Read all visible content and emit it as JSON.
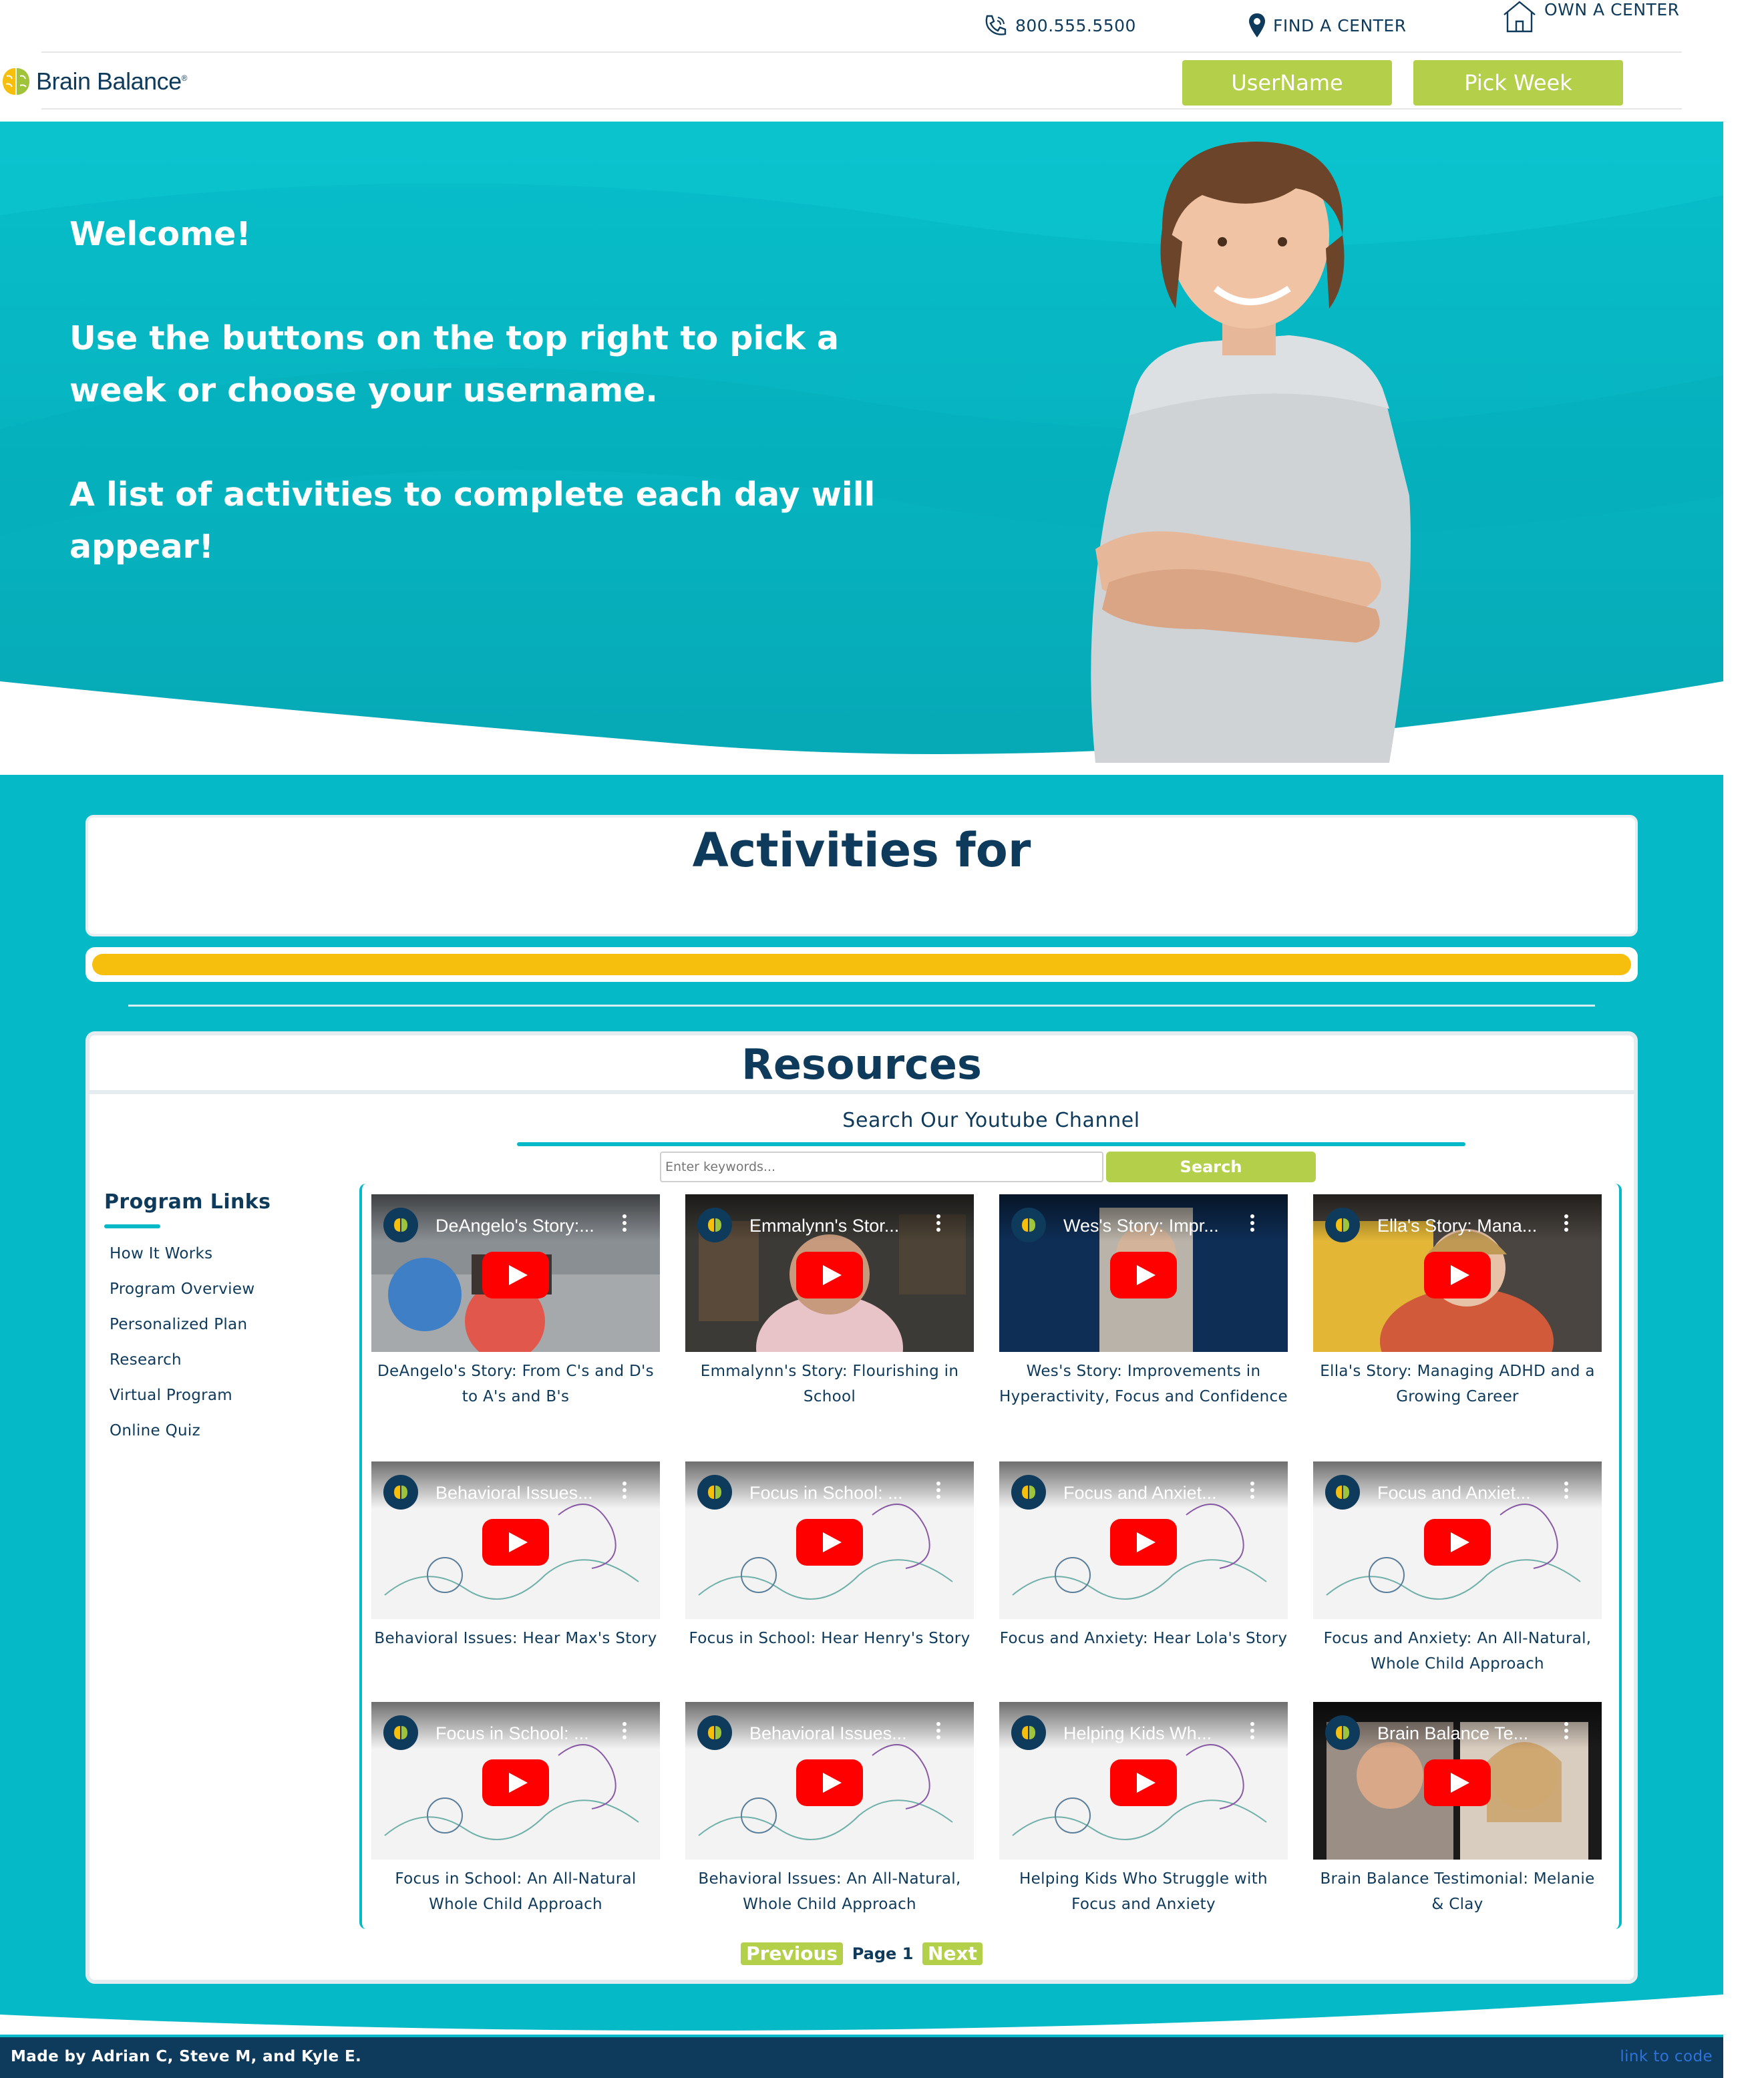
{
  "header": {
    "phone": "800.555.5500",
    "find_center": "FIND A CENTER",
    "own_center": "OWN A CENTER",
    "brand_name": "Brain Balance",
    "brand_mark": "®",
    "username_button": "UserName",
    "pick_week_button": "Pick Week"
  },
  "hero": {
    "line1": "Welcome!",
    "line2": "Use the buttons on the top right to pick a week or choose your username.",
    "line3": "A list of activities to complete each day will appear!"
  },
  "activities": {
    "title": "Activities for",
    "progress_fraction": 1.0
  },
  "resources": {
    "title": "Resources",
    "youtube_heading": "Search Our Youtube Channel",
    "search_placeholder": "Enter keywords...",
    "search_button": "Search",
    "program_links_heading": "Program Links",
    "program_links": [
      "How It Works",
      "Program Overview",
      "Personalized Plan",
      "Research",
      "Virtual Program",
      "Online Quiz"
    ],
    "videos": [
      {
        "thumb_title": "DeAngelo's Story:...",
        "caption": "DeAngelo's Story: From C's and D's to A's and B's",
        "scene": "gym"
      },
      {
        "thumb_title": "Emmalynn's Stor...",
        "caption": "Emmalynn's Story: Flourishing in School",
        "scene": "room"
      },
      {
        "thumb_title": "Wes's Story: Impr...",
        "caption": "Wes's Story: Improvements in Hyperactivity, Focus and Confidence",
        "scene": "navy"
      },
      {
        "thumb_title": "Ella's Story: Mana...",
        "caption": "Ella's Story: Managing ADHD and a Growing Career",
        "scene": "yellow"
      },
      {
        "thumb_title": "Behavioral Issues...",
        "caption": "Behavioral Issues: Hear Max's Story",
        "scene": "sketch"
      },
      {
        "thumb_title": "Focus in School: ...",
        "caption": "Focus in School: Hear Henry's Story",
        "scene": "sketch"
      },
      {
        "thumb_title": "Focus and Anxiet...",
        "caption": "Focus and Anxiety: Hear Lola's Story",
        "scene": "sketch"
      },
      {
        "thumb_title": "Focus and Anxiet...",
        "caption": "Focus and Anxiety: An All-Natural, Whole Child Approach",
        "scene": "sketch"
      },
      {
        "thumb_title": "Focus in School: ...",
        "caption": "Focus in School: An All-Natural Whole Child Approach",
        "scene": "sketch"
      },
      {
        "thumb_title": "Behavioral Issues...",
        "caption": "Behavioral Issues: An All-Natural, Whole Child Approach",
        "scene": "sketch"
      },
      {
        "thumb_title": "Helping Kids Wh...",
        "caption": "Helping Kids Who Struggle with Focus and Anxiety",
        "scene": "sketch"
      },
      {
        "thumb_title": "Brain Balance Te...",
        "caption": "Brain Balance Testimonial: Melanie & Clay",
        "scene": "couple"
      }
    ],
    "pager": {
      "previous": "Previous",
      "page_label": "Page 1",
      "next": "Next"
    }
  },
  "footer": {
    "credit": "Made by Adrian C, Steve M, and Kyle E.",
    "code_link": "link to code"
  },
  "icons": {
    "phone": "phone-icon",
    "location": "location-pin-icon",
    "house": "house-icon",
    "play": "youtube-play-icon"
  },
  "colors": {
    "teal": "#05b9c7",
    "navy": "#0e3a5b",
    "lime": "#b4cf4a",
    "progress": "#f6bf0e",
    "youtube_red": "#ff0000"
  }
}
